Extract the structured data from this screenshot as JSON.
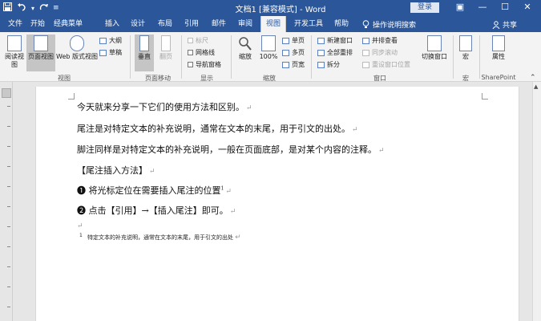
{
  "titlebar": {
    "save_icon": "save-icon",
    "undo_icon": "undo-icon",
    "undo_dropdown": "▾",
    "redo_icon": "redo-icon",
    "customize": "≡",
    "title": "文档1 [兼容模式] - Word",
    "login": "登录",
    "ribbon_display": "▣",
    "minimize": "—",
    "maximize": "☐",
    "close": "✕"
  },
  "tabs": [
    {
      "label": "文件"
    },
    {
      "label": "开始"
    },
    {
      "label": "经典菜单"
    },
    {
      "label": "插入"
    },
    {
      "label": "设计"
    },
    {
      "label": "布局"
    },
    {
      "label": "引用"
    },
    {
      "label": "邮件"
    },
    {
      "label": "审阅"
    },
    {
      "label": "视图"
    },
    {
      "label": "开发工具"
    },
    {
      "label": "帮助"
    }
  ],
  "active_tab": "视图",
  "tellme": "操作说明搜索",
  "share": "共享",
  "ribbon": {
    "views": {
      "read_mode": "阅读视图",
      "print_layout": "页面视图",
      "web_layout": "Web 版式视图",
      "outline": "大纲",
      "draft": "草稿",
      "label": "视图"
    },
    "page_move": {
      "vertical": "垂直",
      "side_to_side": "翻页",
      "label": "页面移动"
    },
    "show": {
      "ruler": "标尺",
      "gridlines": "网格线",
      "nav_pane": "导航窗格",
      "label": "显示"
    },
    "zoom": {
      "zoom": "缩放",
      "zoom_100": "100%",
      "one_page": "单页",
      "multi_page": "多页",
      "page_width": "页宽",
      "label": "缩放"
    },
    "window": {
      "new_window": "新建窗口",
      "arrange_all": "全部重排",
      "split": "拆分",
      "side_by_side": "并排查看",
      "sync_scroll": "同步滚动",
      "reset_position": "重设窗口位置",
      "switch_windows": "切换窗口",
      "label": "窗口"
    },
    "macros": {
      "macros": "宏",
      "label": "宏"
    },
    "sharepoint": {
      "properties": "属性",
      "label": "SharePoint"
    }
  },
  "document": {
    "lines": [
      "今天就来分享一下它们的使用方法和区别。",
      "尾注是对特定文本的补充说明，通常在文本的末尾，用于引文的出处。",
      "脚注同样是对特定文本的补充说明，一般在页面底部，是对某个内容的注释。",
      "【尾注插入方法】",
      "❶  将光标定位在需要插入尾注的位置",
      "❷  点击【引用】→【插入尾注】即可。"
    ],
    "endnote_ref": "1",
    "para_mark": "↵",
    "footnote_ref": "1",
    "footnote_text": "特定文本的补充说明，通常在文本的末尾，用于引文的出处"
  },
  "colors": {
    "accent": "#2b579a",
    "ribbon_bg": "#f3f3f3",
    "workspace": "#e6e6e6"
  }
}
